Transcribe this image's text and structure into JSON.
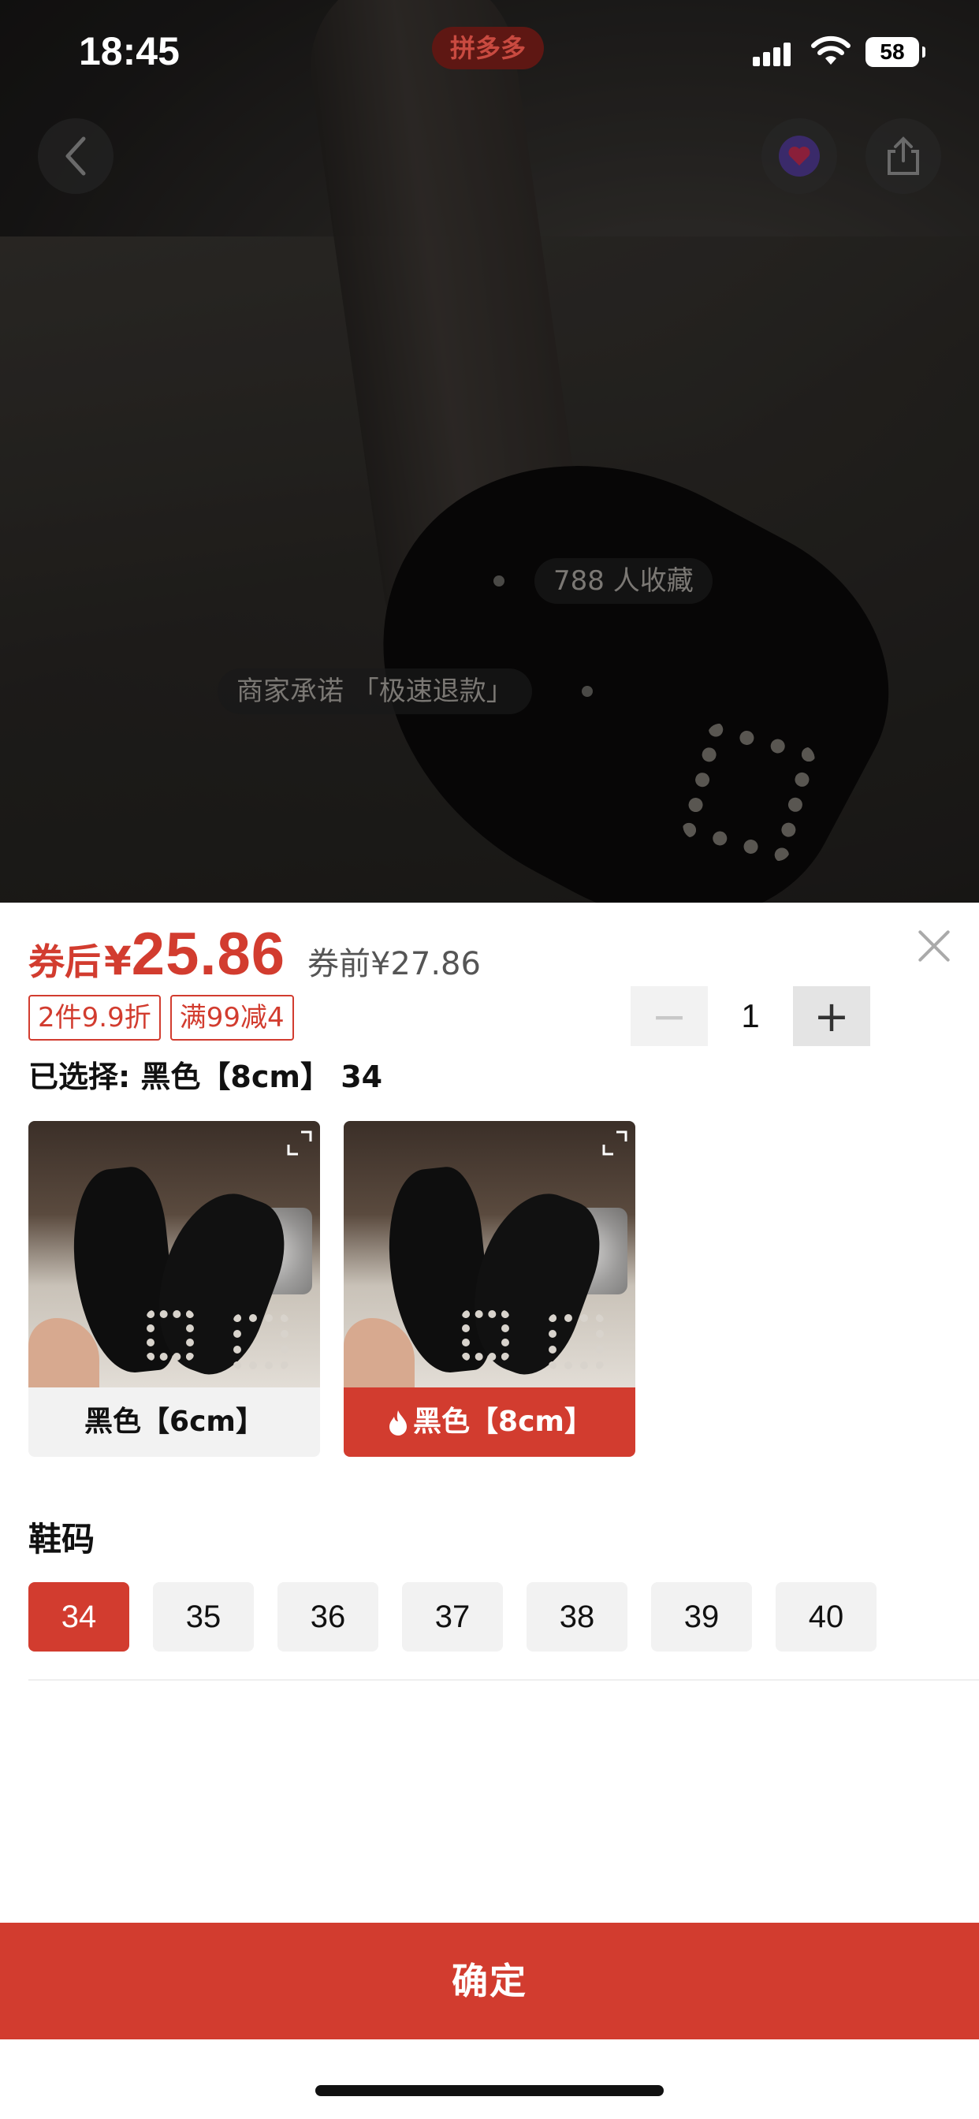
{
  "status_bar": {
    "time": "18:45",
    "app_badge": "拼多多",
    "battery": "58"
  },
  "hero": {
    "favorites_count_text": "788 人收藏",
    "merchant_promise_text": "商家承诺 「极速退款」",
    "icons": [
      "back-icon",
      "favorite-icon",
      "share-icon"
    ]
  },
  "price": {
    "after_label": "券后",
    "currency": "¥",
    "after_value": "25.86",
    "before_text": "券前¥27.86"
  },
  "tags": [
    "2件9.9折",
    "满99减4"
  ],
  "quantity": {
    "value": "1",
    "minus": "−",
    "plus": "+"
  },
  "selection_text": "已选择: 黑色【8cm】 34",
  "variants": [
    {
      "label": "黑色【6cm】",
      "selected": false
    },
    {
      "label": "黑色【8cm】",
      "selected": true,
      "hot": true
    }
  ],
  "size_section": {
    "title": "鞋码",
    "options": [
      "34",
      "35",
      "36",
      "37",
      "38",
      "39",
      "40"
    ],
    "selected": "34"
  },
  "confirm_label": "确定",
  "colors": {
    "accent": "#d23c2f",
    "chip_bg": "#f2f2f2"
  }
}
